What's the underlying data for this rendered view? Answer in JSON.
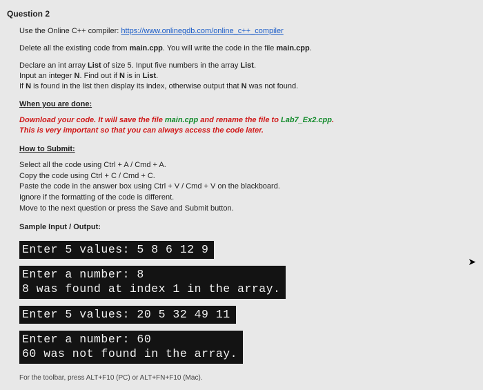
{
  "question": {
    "label": "Question 2"
  },
  "intro": {
    "prefix": "Use the Online C++ compiler: ",
    "link_text": "https://www.onlinegdb.com/online_c++_compiler",
    "delete_line_a": "Delete all the existing code from ",
    "main1": "main.cpp",
    "delete_line_b": ". You will write the code in the file ",
    "main2": "main.cpp",
    "delete_line_c": "."
  },
  "task": {
    "l1a": "Declare an int array ",
    "l1b": "List",
    "l1c": " of size 5. Input five numbers in the array ",
    "l1d": "List",
    "l1e": ".",
    "l2a": "Input an integer ",
    "l2b": "N",
    "l2c": ". Find out if ",
    "l2d": "N",
    "l2e": " is in ",
    "l2f": "List",
    "l2g": ".",
    "l3a": "If ",
    "l3b": "N",
    "l3c": " is found in the list then display its index, otherwise output that ",
    "l3d": "N",
    "l3e": " was not found."
  },
  "done_heading": "When you are done:",
  "dl": {
    "a": "Download your code. It will save the file ",
    "main": "main.cpp",
    "b": " and rename the file to ",
    "lab": "Lab7_Ex2.cpp",
    "c": ".",
    "important": "This is very important so that you can always access the code later."
  },
  "submit_heading": "How to Submit:",
  "steps": {
    "s1": "Select all the code using Ctrl + A / Cmd + A.",
    "s2": "Copy the code using Ctrl + C / Cmd + C.",
    "s3": "Paste the code in the answer box using Ctrl + V / Cmd + V on the blackboard.",
    "s4": "Ignore if the formatting of the code is different.",
    "s5": "Move to the next question or press the Save and Submit button."
  },
  "sample_heading": "Sample Input / Output:",
  "run1": {
    "line1": "Enter 5 values: 5 8 6 12 9",
    "line2": "Enter a number: 8",
    "line3": "8 was found at index 1 in the array."
  },
  "run2": {
    "line1": "Enter 5 values: 20 5 32 49 11",
    "line2": "Enter a number: 60",
    "line3": "60 was not found in the array."
  },
  "footnote": "For the toolbar, press ALT+F10 (PC) or ALT+FN+F10 (Mac)."
}
